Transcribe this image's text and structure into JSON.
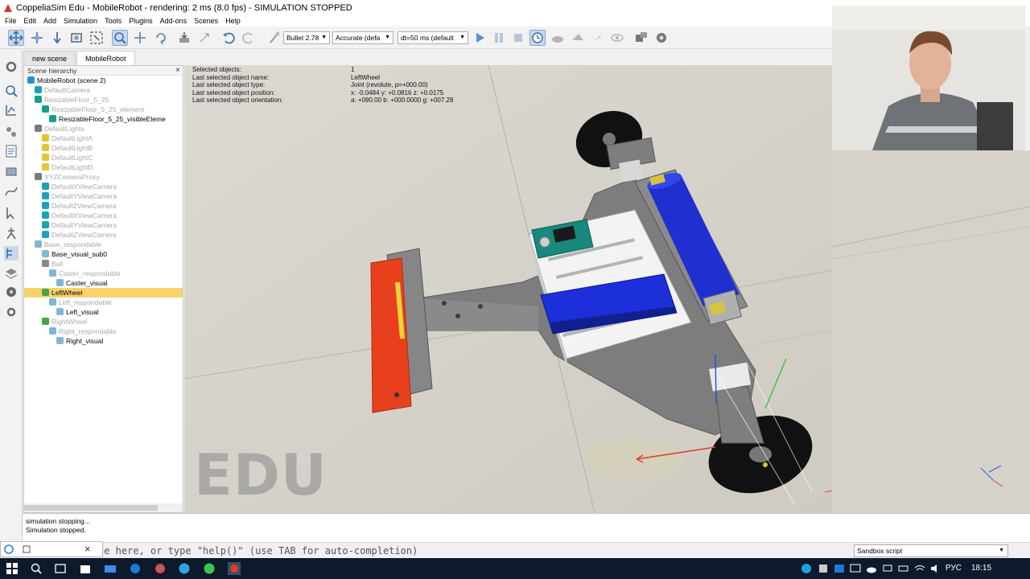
{
  "window": {
    "title": "CoppeliaSim Edu - MobileRobot - rendering: 2 ms (8.0 fps) - SIMULATION STOPPED"
  },
  "menu": [
    "File",
    "Edit",
    "Add",
    "Simulation",
    "Tools",
    "Plugins",
    "Add-ons",
    "Scenes",
    "Help"
  ],
  "toolbar": {
    "engine": "Bullet 2.78",
    "accuracy": "Accurate (defa",
    "timestep": "dt=50 ms (default"
  },
  "tabs": [
    "new scene",
    "MobileRobot"
  ],
  "hierarchy": {
    "title": "Scene hierarchy",
    "items": [
      "MobileRobot (scene 2)",
      "DefaultCamera",
      "ResizableFloor_5_25",
      "ResizableFloor_5_25_element",
      "ResizableFloor_5_25_visibleEleme",
      "DefaultLights",
      "DefaultLightA",
      "DefaultLightB",
      "DefaultLightC",
      "DefaultLightD",
      "XYZCameraProxy",
      "DefaultXViewCamera",
      "DefaultYViewCamera",
      "DefaultZViewCamera",
      "DefaultXViewCamera",
      "DefaultYViewCamera",
      "DefaultZViewCamera",
      "Base_respondable",
      "Base_visual_sub0",
      "Ball",
      "Caster_respondable",
      "Caster_visual",
      "LeftWheel",
      "Left_respondable",
      "Left_visual",
      "RightWheel",
      "Right_respondable",
      "Right_visual"
    ]
  },
  "info": [
    {
      "label": "Selected objects:",
      "value": "1"
    },
    {
      "label": "Last selected object name:",
      "value": "LeftWheel"
    },
    {
      "label": "Last selected object type:",
      "value": "Joint (revolute, p=+000.00)"
    },
    {
      "label": "Last selected object position:",
      "value": "x: -0.0484    y: +0.0816    z: +0.0175"
    },
    {
      "label": "Last selected object orientation:",
      "value": "a: +090.00    b: +000.0000    g: +007.28"
    }
  ],
  "watermark": "EDU",
  "log": [
    "simulation stopping...",
    "Simulation stopped."
  ],
  "command": {
    "placeholder": "de here, or type \"help()\" (use TAB for auto-completion)",
    "script": "Sandbox script"
  },
  "taskbar": {
    "language": "РУС",
    "time": "18:15"
  },
  "colors": {
    "selection": "#f7d36a",
    "taskbar": "#0d1a2b"
  }
}
